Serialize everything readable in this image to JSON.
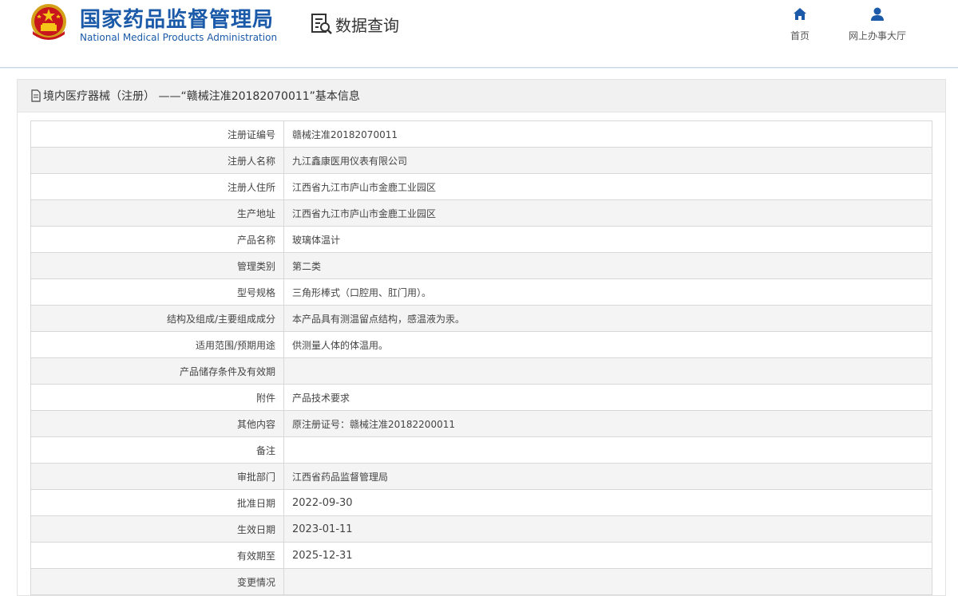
{
  "header": {
    "org_name_cn": "国家药品监督管理局",
    "org_name_en": "National Medical Products Administration",
    "query_title": "数据查询",
    "nav": [
      {
        "label": "首页",
        "icon": "home-icon"
      },
      {
        "label": "网上办事大厅",
        "icon": "user-icon"
      }
    ]
  },
  "panel": {
    "title": "境内医疗器械（注册） ——“赣械注准20182070011”基本信息"
  },
  "colors": {
    "brand_blue": "#1a5aa8",
    "row_alt": "#f4f4f4",
    "border": "#d8d8d8"
  },
  "rows": [
    {
      "label": "注册证编号",
      "value": "赣械注准20182070011"
    },
    {
      "label": "注册人名称",
      "value": "九江鑫康医用仪表有限公司"
    },
    {
      "label": "注册人住所",
      "value": "江西省九江市庐山市金鹿工业园区"
    },
    {
      "label": "生产地址",
      "value": "江西省九江市庐山市金鹿工业园区"
    },
    {
      "label": "产品名称",
      "value": "玻璃体温计"
    },
    {
      "label": "管理类别",
      "value": "第二类"
    },
    {
      "label": "型号规格",
      "value": "三角形棒式（口腔用、肛门用）。"
    },
    {
      "label": "结构及组成/主要组成成分",
      "value": "本产品具有测温留点结构，感温液为汞。"
    },
    {
      "label": "适用范围/预期用途",
      "value": "供测量人体的体温用。"
    },
    {
      "label": "产品储存条件及有效期",
      "value": ""
    },
    {
      "label": "附件",
      "value": "产品技术要求"
    },
    {
      "label": "其他内容",
      "value": "原注册证号：赣械注准20182200011"
    },
    {
      "label": "备注",
      "value": ""
    },
    {
      "label": "审批部门",
      "value": "江西省药品监督管理局"
    },
    {
      "label": "批准日期",
      "value": "2022-09-30"
    },
    {
      "label": "生效日期",
      "value": "2023-01-11"
    },
    {
      "label": "有效期至",
      "value": "2025-12-31"
    },
    {
      "label": "变更情况",
      "value": ""
    }
  ]
}
